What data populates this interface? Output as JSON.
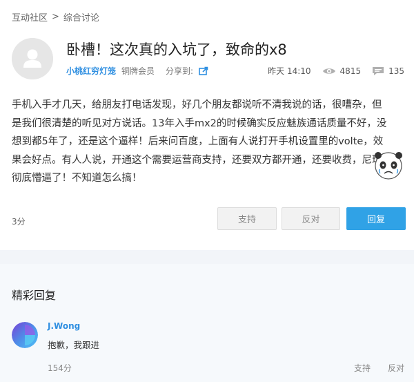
{
  "breadcrumb": {
    "root": "互动社区",
    "separator": ">",
    "current": "综合讨论"
  },
  "post": {
    "title": "卧槽！这次真的入坑了，致命的x8",
    "author": "小桃红穷灯笼",
    "rank": "铜牌会员",
    "share_label": "分享到:",
    "time": "昨天 14:10",
    "views": "4815",
    "comments": "135",
    "content": "手机入手才几天，给朋友打电话发现，好几个朋友都说听不清我说的话，很嘈杂，但是我们很清楚的听见对方说话。13年入手mx2的时候确实反应魅族通话质量不好，没想到都5年了，还是这个逼样！后来问百度，上面有人说打开手机设置里的volte，效果会好点。有人人说，开通这个需要运营商支持，还要双方都开通，还要收费，尼玛彻底懵逼了！不知道怎么搞！",
    "score": "3分",
    "buttons": {
      "support": "支持",
      "oppose": "反对",
      "reply": "回复"
    }
  },
  "replies": {
    "section_title": "精彩回复",
    "items": [
      {
        "author": "J.Wong",
        "text": "抱歉，我跟进",
        "score": "154分",
        "support": "支持",
        "oppose": "反对"
      }
    ]
  },
  "colors": {
    "link_blue": "#2f8fe1",
    "reply_button": "#30a2e6",
    "section_bg": "#f6f9fc"
  },
  "icons": {
    "share": "share-icon",
    "views": "eye-icon",
    "comments": "comment-icon"
  }
}
